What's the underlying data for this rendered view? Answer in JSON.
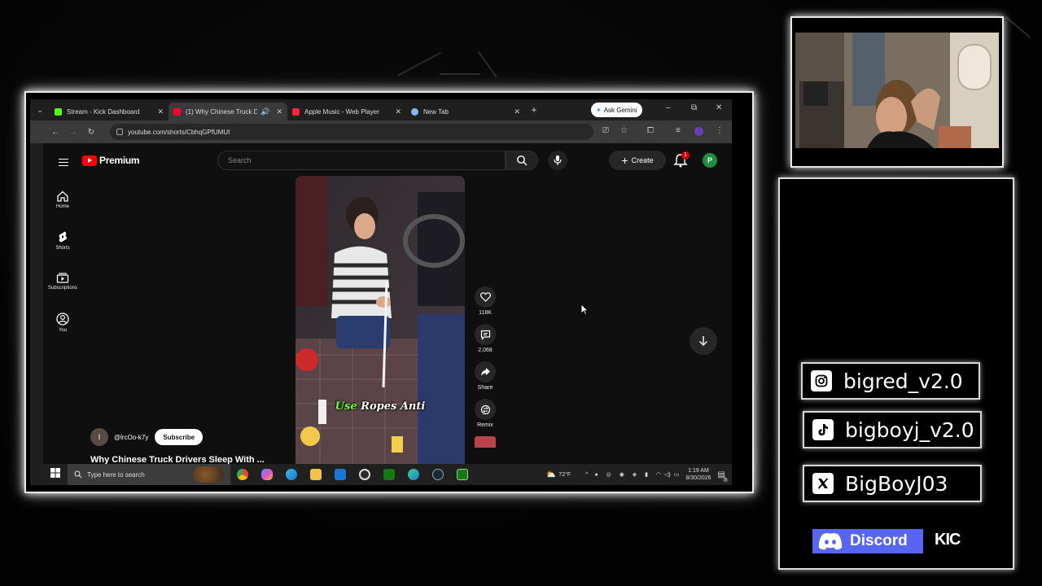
{
  "browser": {
    "tabs": [
      {
        "label": "Stream - Kick Dashboard",
        "favicon_color": "#53fc18",
        "active": false
      },
      {
        "label": "(1) Why Chinese Truck D",
        "favicon_color": "#ff0033",
        "active": true
      },
      {
        "label": "Apple Music - Web Player",
        "favicon_color": "#fa243c",
        "active": false
      },
      {
        "label": "New Tab",
        "favicon_color": "#8ab4f8",
        "active": false
      }
    ],
    "gemini_label": "Ask Gemini",
    "url": "youtube.com/shorts/CbhqGPfUMUI"
  },
  "youtube": {
    "brand": "Premium",
    "search_placeholder": "Search",
    "create_label": "Create",
    "notification_count": "1",
    "avatar_letter": "P",
    "nav": [
      {
        "label": "Home",
        "icon": "home-icon"
      },
      {
        "label": "Shorts",
        "icon": "shorts-icon"
      },
      {
        "label": "Subscriptions",
        "icon": "subscriptions-icon"
      },
      {
        "label": "You",
        "icon": "you-icon"
      }
    ],
    "caption_highlight": "Use",
    "caption_rest": "Ropes Anti",
    "actions": {
      "likes": "118K",
      "comments": "2,068",
      "share": "Share",
      "remix": "Remix"
    },
    "channel_initial": "I",
    "channel_name": "@lrcOo-k7y",
    "subscribe_label": "Subscribe",
    "video_title": "Why Chinese Truck Drivers Sleep With ..."
  },
  "taskbar": {
    "search_placeholder": "Type here to search",
    "weather": "72°F",
    "time": "1:19 AM",
    "date": "8/30/2026",
    "notification_badge": "6"
  },
  "socials": [
    {
      "handle": "bigred_v2.0",
      "icon": "instagram-icon"
    },
    {
      "handle": "bigboyj_v2.0",
      "icon": "tiktok-icon"
    },
    {
      "handle": "BigBoyJ03",
      "icon": "x-icon"
    }
  ],
  "discord_label": "Discord",
  "kick_label": "KIC",
  "colors": {
    "youtube_red": "#ff0000",
    "discord_blurple": "#5865f2",
    "avatar_green": "#1e8e3e"
  }
}
